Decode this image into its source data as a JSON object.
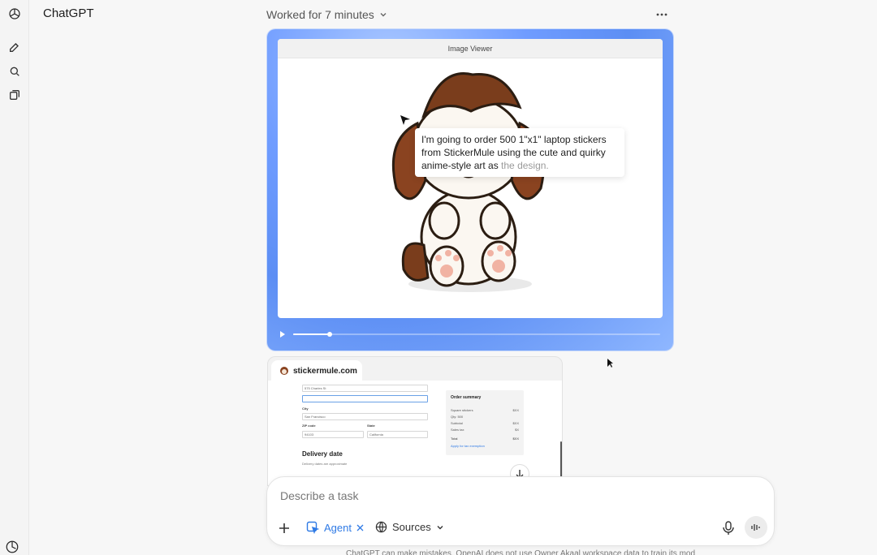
{
  "app": {
    "title": "ChatGPT"
  },
  "header": {
    "status": "Worked for 7 minutes"
  },
  "viewer": {
    "title": "Image Viewer",
    "progress": 0.1
  },
  "tooltip": {
    "text_main": "I'm going to order 500 1\"x1\" laptop stickers from StickerMule using the cute and quirky anime-style art as ",
    "text_faded": "the design."
  },
  "browser": {
    "tab_label": "stickermule.com",
    "form": {
      "address2_value": "575 Charles St",
      "city_label": "City",
      "city_value": "San Francisco",
      "zip_label": "ZIP code",
      "zip_value": "94103",
      "state_label": "State",
      "state_value": "California",
      "delivery_heading": "Delivery date",
      "delivery_note": "Delivery dates are approximate"
    },
    "order": {
      "title": "Order summary",
      "lines": [
        {
          "label": "Square stickers",
          "value": "$XX"
        },
        {
          "label": "Qty: 500",
          "value": ""
        },
        {
          "label": "Subtotal",
          "value": "$XX"
        },
        {
          "label": "Sales tax",
          "value": "$X"
        }
      ],
      "total_label": "Total",
      "total_value": "$XX",
      "tax_link": "Apply for tax exemption"
    }
  },
  "composer": {
    "placeholder": "Describe a task",
    "agent_label": "Agent",
    "sources_label": "Sources"
  },
  "footer": {
    "text": "ChatGPT can make mistakes. OpenAI does not use Owner Akaal workspace data to train its models."
  },
  "colors": {
    "accent": "#2f7ae5",
    "viewer_frame": "#6f9cff"
  }
}
